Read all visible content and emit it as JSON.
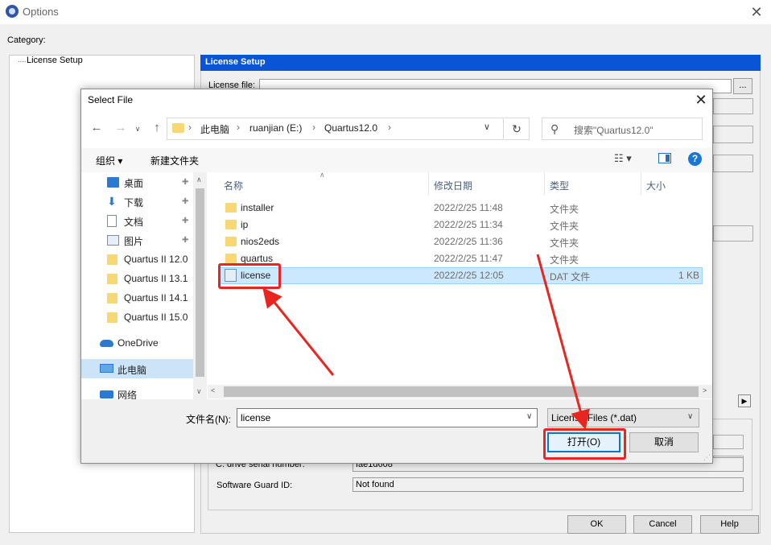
{
  "options_window": {
    "title": "Options",
    "close_glyph": "✕",
    "category_label": "Category:",
    "tree_item": "License Setup",
    "panel_header": "License Setup",
    "license_file_label": "License file:",
    "browse_label": "...",
    "drive_serial_label": "C: drive serial number:",
    "drive_serial_value": "fae1d608",
    "guard_label": "Software Guard ID:",
    "guard_value": "Not found",
    "ok_label": "OK",
    "cancel_label": "Cancel",
    "help_label": "Help"
  },
  "dialog": {
    "title": "Select File",
    "close_glyph": "✕",
    "nav_back": "←",
    "nav_forward": "→",
    "nav_recent": "∨",
    "nav_up": "↑",
    "breadcrumbs": [
      "此电脑",
      "ruanjian (E:)",
      "Quartus12.0"
    ],
    "crumb_separator": "›",
    "refresh_glyph": "↻",
    "search_icon_glyph": "⚲",
    "search_placeholder": "搜索\"Quartus12.0\"",
    "toolbar": {
      "organize": "组织 ▾",
      "new_folder": "新建文件夹",
      "view_glyph": "☷ ▾",
      "help_glyph": "?"
    },
    "nav_items": [
      {
        "label": "桌面",
        "icon": "desktop-icon",
        "pinned": true
      },
      {
        "label": "下载",
        "icon": "download-icon",
        "pinned": true
      },
      {
        "label": "文档",
        "icon": "document-icon",
        "pinned": true
      },
      {
        "label": "图片",
        "icon": "picture-icon",
        "pinned": true
      },
      {
        "label": "Quartus II 12.0",
        "icon": "folder-icon",
        "pinned": false
      },
      {
        "label": "Quartus II 13.1",
        "icon": "folder-icon",
        "pinned": false
      },
      {
        "label": "Quartus II 14.1",
        "icon": "folder-icon",
        "pinned": false
      },
      {
        "label": "Quartus II 15.0",
        "icon": "folder-icon",
        "pinned": false
      },
      {
        "label": "OneDrive",
        "icon": "cloud-icon",
        "pinned": false
      },
      {
        "label": "此电脑",
        "icon": "computer-icon",
        "pinned": false,
        "selected": true
      },
      {
        "label": "网络",
        "icon": "network-icon",
        "pinned": false
      }
    ],
    "pin_glyph": "📌",
    "columns": [
      "名称",
      "修改日期",
      "类型",
      "大小"
    ],
    "files": [
      {
        "name": "installer",
        "date": "2022/2/25 11:48",
        "type": "文件夹",
        "size": ""
      },
      {
        "name": "ip",
        "date": "2022/2/25 11:34",
        "type": "文件夹",
        "size": ""
      },
      {
        "name": "nios2eds",
        "date": "2022/2/25 11:36",
        "type": "文件夹",
        "size": ""
      },
      {
        "name": "quartus",
        "date": "2022/2/25 11:47",
        "type": "文件夹",
        "size": ""
      },
      {
        "name": "license",
        "date": "2022/2/25 12:05",
        "type": "DAT 文件",
        "size": "1 KB",
        "selected": true
      }
    ],
    "filename_label": "文件名(N):",
    "filename_value": "license",
    "filetype_value": "License Files (*.dat)",
    "open_label": "打开(O)",
    "cancel_label": "取消"
  },
  "annotation_color": "#e8261f",
  "accent_color": "#0a54d6"
}
